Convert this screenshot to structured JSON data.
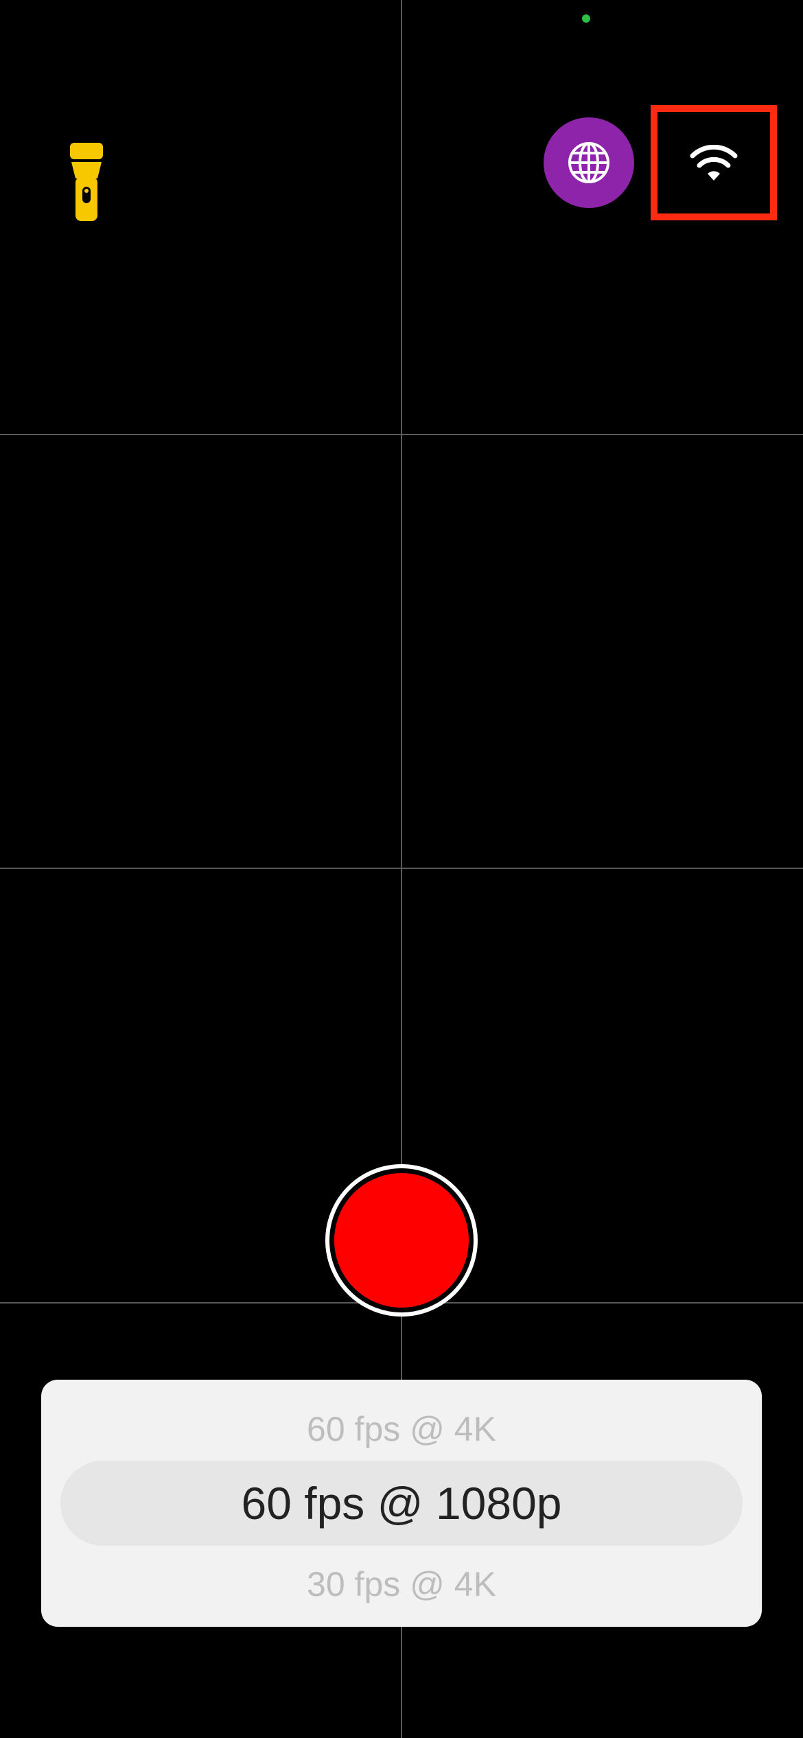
{
  "colors": {
    "background": "#000000",
    "grid": "#5a5a5a",
    "privacy_indicator": "#2fbf46",
    "flashlight": "#f7c800",
    "globe_button": "#8e24aa",
    "wifi_highlight": "#ff2a12",
    "record": "#ff0000",
    "picker_bg": "#f2f2f2"
  },
  "icons": {
    "flashlight": "flashlight-icon",
    "globe": "globe-icon",
    "wifi": "wifi-icon"
  },
  "picker": {
    "options": [
      "60 fps @ 4K",
      "60 fps @ 1080p",
      "30 fps @ 4K"
    ],
    "selected": "60 fps @ 1080p"
  }
}
